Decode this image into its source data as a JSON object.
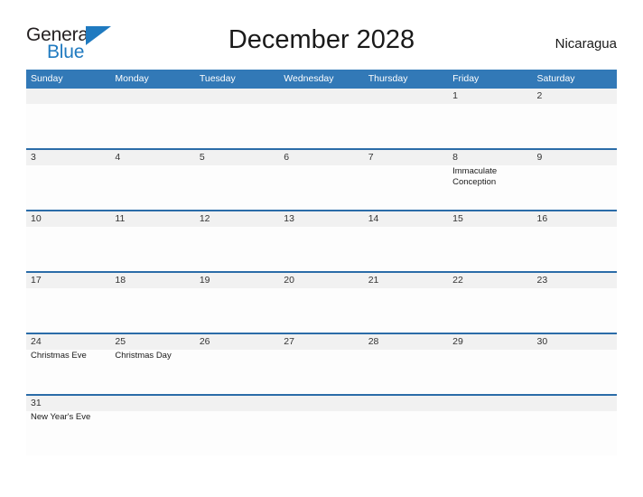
{
  "brand": {
    "name_part1": "General",
    "name_part2": "Blue",
    "flag_icon": "flag-icon",
    "accent_color": "#1f7ac0"
  },
  "header": {
    "title": "December 2028",
    "country": "Nicaragua"
  },
  "calendar": {
    "month": "December",
    "year": "2028",
    "header_bg": "#3279b7",
    "row_rule_color": "#2b6ca8",
    "date_band_bg": "#f1f1f1",
    "weekday_names": [
      "Sunday",
      "Monday",
      "Tuesday",
      "Wednesday",
      "Thursday",
      "Friday",
      "Saturday"
    ],
    "weeks": [
      [
        {
          "date": "",
          "events": []
        },
        {
          "date": "",
          "events": []
        },
        {
          "date": "",
          "events": []
        },
        {
          "date": "",
          "events": []
        },
        {
          "date": "",
          "events": []
        },
        {
          "date": "1",
          "events": []
        },
        {
          "date": "2",
          "events": []
        }
      ],
      [
        {
          "date": "3",
          "events": []
        },
        {
          "date": "4",
          "events": []
        },
        {
          "date": "5",
          "events": []
        },
        {
          "date": "6",
          "events": []
        },
        {
          "date": "7",
          "events": []
        },
        {
          "date": "8",
          "events": [
            "Immaculate Conception"
          ]
        },
        {
          "date": "9",
          "events": []
        }
      ],
      [
        {
          "date": "10",
          "events": []
        },
        {
          "date": "11",
          "events": []
        },
        {
          "date": "12",
          "events": []
        },
        {
          "date": "13",
          "events": []
        },
        {
          "date": "14",
          "events": []
        },
        {
          "date": "15",
          "events": []
        },
        {
          "date": "16",
          "events": []
        }
      ],
      [
        {
          "date": "17",
          "events": []
        },
        {
          "date": "18",
          "events": []
        },
        {
          "date": "19",
          "events": []
        },
        {
          "date": "20",
          "events": []
        },
        {
          "date": "21",
          "events": []
        },
        {
          "date": "22",
          "events": []
        },
        {
          "date": "23",
          "events": []
        }
      ],
      [
        {
          "date": "24",
          "events": [
            "Christmas Eve"
          ]
        },
        {
          "date": "25",
          "events": [
            "Christmas Day"
          ]
        },
        {
          "date": "26",
          "events": []
        },
        {
          "date": "27",
          "events": []
        },
        {
          "date": "28",
          "events": []
        },
        {
          "date": "29",
          "events": []
        },
        {
          "date": "30",
          "events": []
        }
      ],
      [
        {
          "date": "31",
          "events": [
            "New Year's Eve"
          ]
        },
        {
          "date": "",
          "events": []
        },
        {
          "date": "",
          "events": []
        },
        {
          "date": "",
          "events": []
        },
        {
          "date": "",
          "events": []
        },
        {
          "date": "",
          "events": []
        },
        {
          "date": "",
          "events": []
        }
      ]
    ]
  }
}
